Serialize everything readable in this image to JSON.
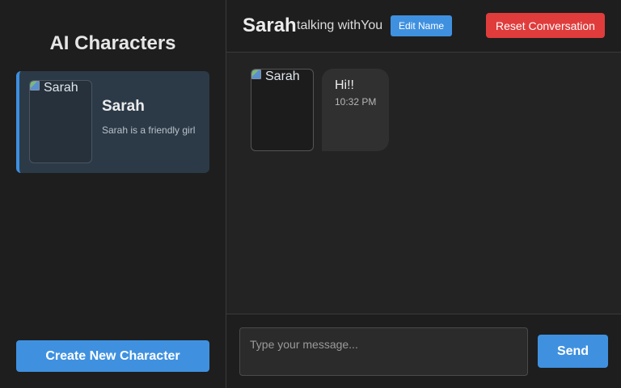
{
  "sidebar": {
    "title": "AI Characters",
    "characters": [
      {
        "name": "Sarah",
        "description": "Sarah is a friendly girl",
        "avatar_alt": "Sarah",
        "active": true
      }
    ],
    "create_button": "Create New Character"
  },
  "header": {
    "character_name": "Sarah",
    "subtitle": "talking withYou",
    "edit_button": "Edit Name",
    "reset_button": "Reset Conversation"
  },
  "messages": [
    {
      "sender": "Sarah",
      "avatar_alt": "Sarah",
      "text": "Hi!!",
      "time": "10:32 PM"
    }
  ],
  "composer": {
    "placeholder": "Type your message...",
    "value": "",
    "send_button": "Send"
  },
  "colors": {
    "accent": "#3f91e0",
    "danger": "#e03c3c",
    "active_card": "#2c3a47",
    "background": "#232323"
  }
}
